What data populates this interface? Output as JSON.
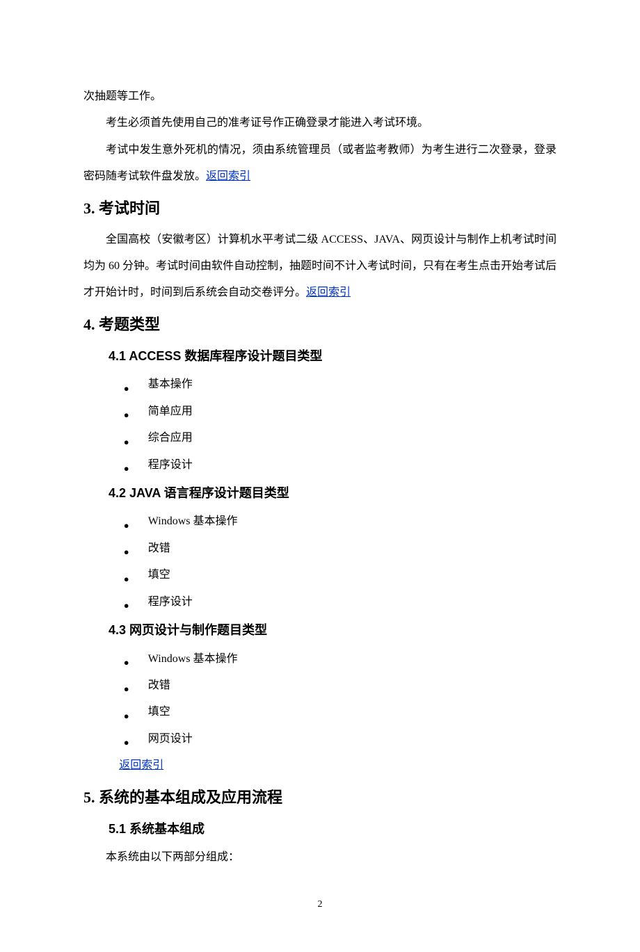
{
  "para1": "次抽题等工作。",
  "para2": "考生必须首先使用自己的准考证号作正确登录才能进入考试环境。",
  "para3_a": "考试中发生意外死机的情况，须由系统管理员（或者监考教师）为考生进行二次登录，登录密码随考试软件盘发放。",
  "return_link": "返回索引",
  "sec3": {
    "heading": "3. 考试时间",
    "para_a": "全国高校（安徽考区）计算机水平考试二级 ACCESS、JAVA、网页设计与制作上机考试时间均为 60 分钟。考试时间由软件自动控制，抽题时间不计入考试时间，只有在考生点击开始考试后才开始计时，时间到后系统会自动交卷评分。"
  },
  "sec4": {
    "heading": "4. 考题类型",
    "sub1": {
      "heading": "4.1 ACCESS 数据库程序设计题目类型",
      "items": [
        "基本操作",
        "简单应用",
        "综合应用",
        "程序设计"
      ]
    },
    "sub2": {
      "heading": "4.2 JAVA 语言程序设计题目类型",
      "items": [
        "Windows 基本操作",
        "改错",
        "填空",
        "程序设计"
      ]
    },
    "sub3": {
      "heading": "4.3 网页设计与制作题目类型",
      "items": [
        "Windows 基本操作",
        "改错",
        "填空",
        "网页设计"
      ]
    }
  },
  "sec5": {
    "heading": "5. 系统的基本组成及应用流程",
    "sub1": {
      "heading": "5.1 系统基本组成",
      "para": "本系统由以下两部分组成："
    }
  },
  "page_number": "2"
}
